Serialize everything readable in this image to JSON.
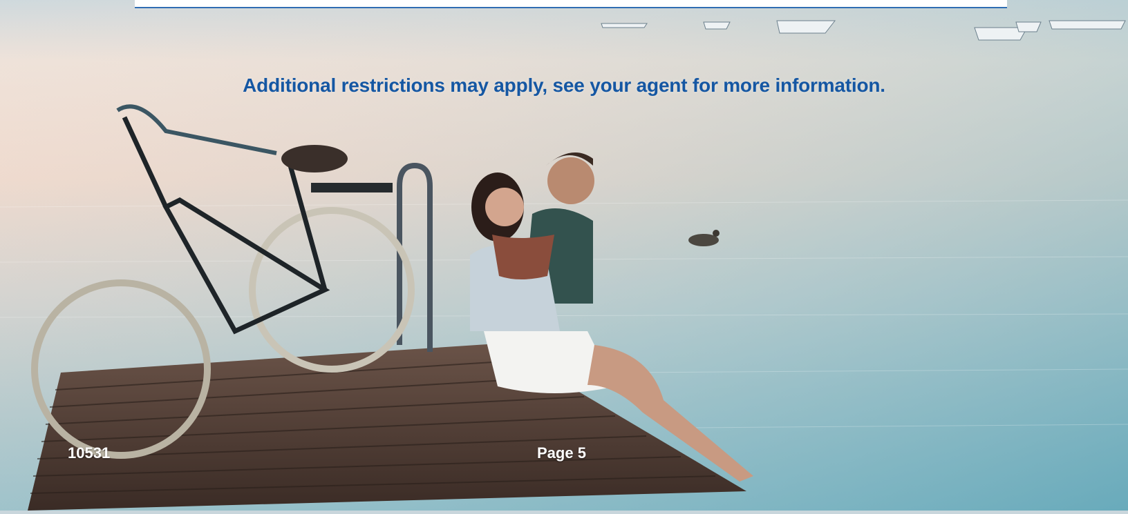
{
  "notice": {
    "text": "Additional restrictions may apply, see your agent for more information."
  },
  "footer": {
    "doc_number": "10531",
    "page_label": "Page 5"
  },
  "colors": {
    "notice_text": "#1557a3",
    "header_rule": "#2f6db3",
    "footer_text": "#ffffff"
  }
}
